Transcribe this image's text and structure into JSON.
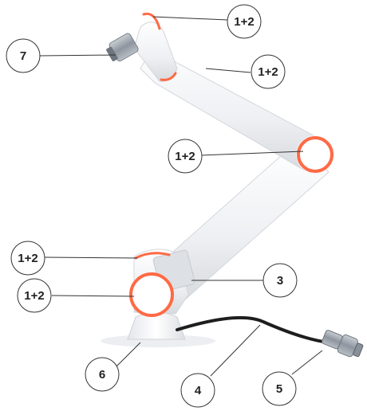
{
  "callouts": [
    {
      "id": "c1",
      "label": "1+2"
    },
    {
      "id": "c2",
      "label": "7"
    },
    {
      "id": "c3",
      "label": "1+2"
    },
    {
      "id": "c4",
      "label": "1+2"
    },
    {
      "id": "c5",
      "label": "1+2"
    },
    {
      "id": "c6",
      "label": "1+2"
    },
    {
      "id": "c7",
      "label": "3"
    },
    {
      "id": "c8",
      "label": "6"
    },
    {
      "id": "c9",
      "label": "4"
    },
    {
      "id": "c10",
      "label": "5"
    }
  ],
  "colors": {
    "arm_body": "#f2f3f5",
    "arm_shade": "#d9dbe0",
    "joint_ring": "#ff6a45",
    "cable": "#1e1e1e",
    "connector": "#9aa1aa",
    "callout_stroke": "#333333"
  }
}
